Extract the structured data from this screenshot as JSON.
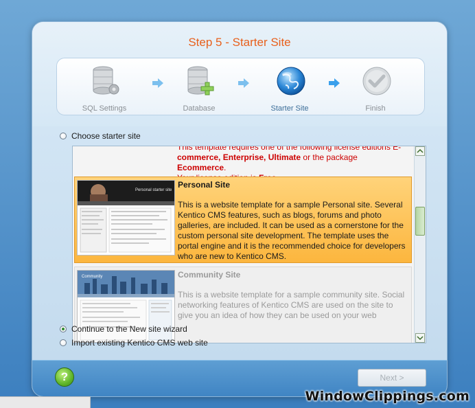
{
  "wizard": {
    "title": "Step 5 - Starter Site",
    "steps": [
      {
        "label": "SQL Settings",
        "icon": "database-settings-icon"
      },
      {
        "label": "Database",
        "icon": "database-add-icon"
      },
      {
        "label": "Starter Site",
        "icon": "globe-icon"
      },
      {
        "label": "Finish",
        "icon": "checkmark-icon"
      }
    ],
    "active_step": "Starter Site"
  },
  "options": {
    "choose_label": "Choose starter site",
    "continue_label": "Continue to the New site wizard",
    "import_label": "Import existing Kentico CMS web site",
    "selected": "continue"
  },
  "list": {
    "top_item": {
      "lic_line1": "This template requires one of the following license editions E-",
      "lic_line2_pre": "commerce, Enterprise, Ultimate",
      "lic_line2_mid": " or the package ",
      "lic_line2_pkg": "Ecommerce",
      "lic_line2_end": ".",
      "lic_line3_pre": "Your license edition is ",
      "lic_line3_ed": "Free",
      "lic_line3_end": "."
    },
    "personal": {
      "title": "Personal Site",
      "description": "This is a website template for a sample Personal site. Several Kentico CMS features, such as blogs, forums and photo galleries, are included. It can be used as a cornerstone for the custom personal site development. The template uses the portal engine and it is the recommended choice for developers who are new to Kentico CMS.",
      "thumb_caption": "Personal starter site"
    },
    "community": {
      "title": "Community Site",
      "description": "This is a website template for a sample community site. Social networking features of Kentico CMS are used on the site to give you an idea of how they can be used on your web",
      "thumb_caption": "Community"
    }
  },
  "footer": {
    "help_label": "?",
    "next_label": "Next >"
  },
  "watermark": "WindowClippings.com",
  "colors": {
    "title": "#e8601c",
    "selection": "#fcb63e",
    "license_red": "#cc0000"
  }
}
